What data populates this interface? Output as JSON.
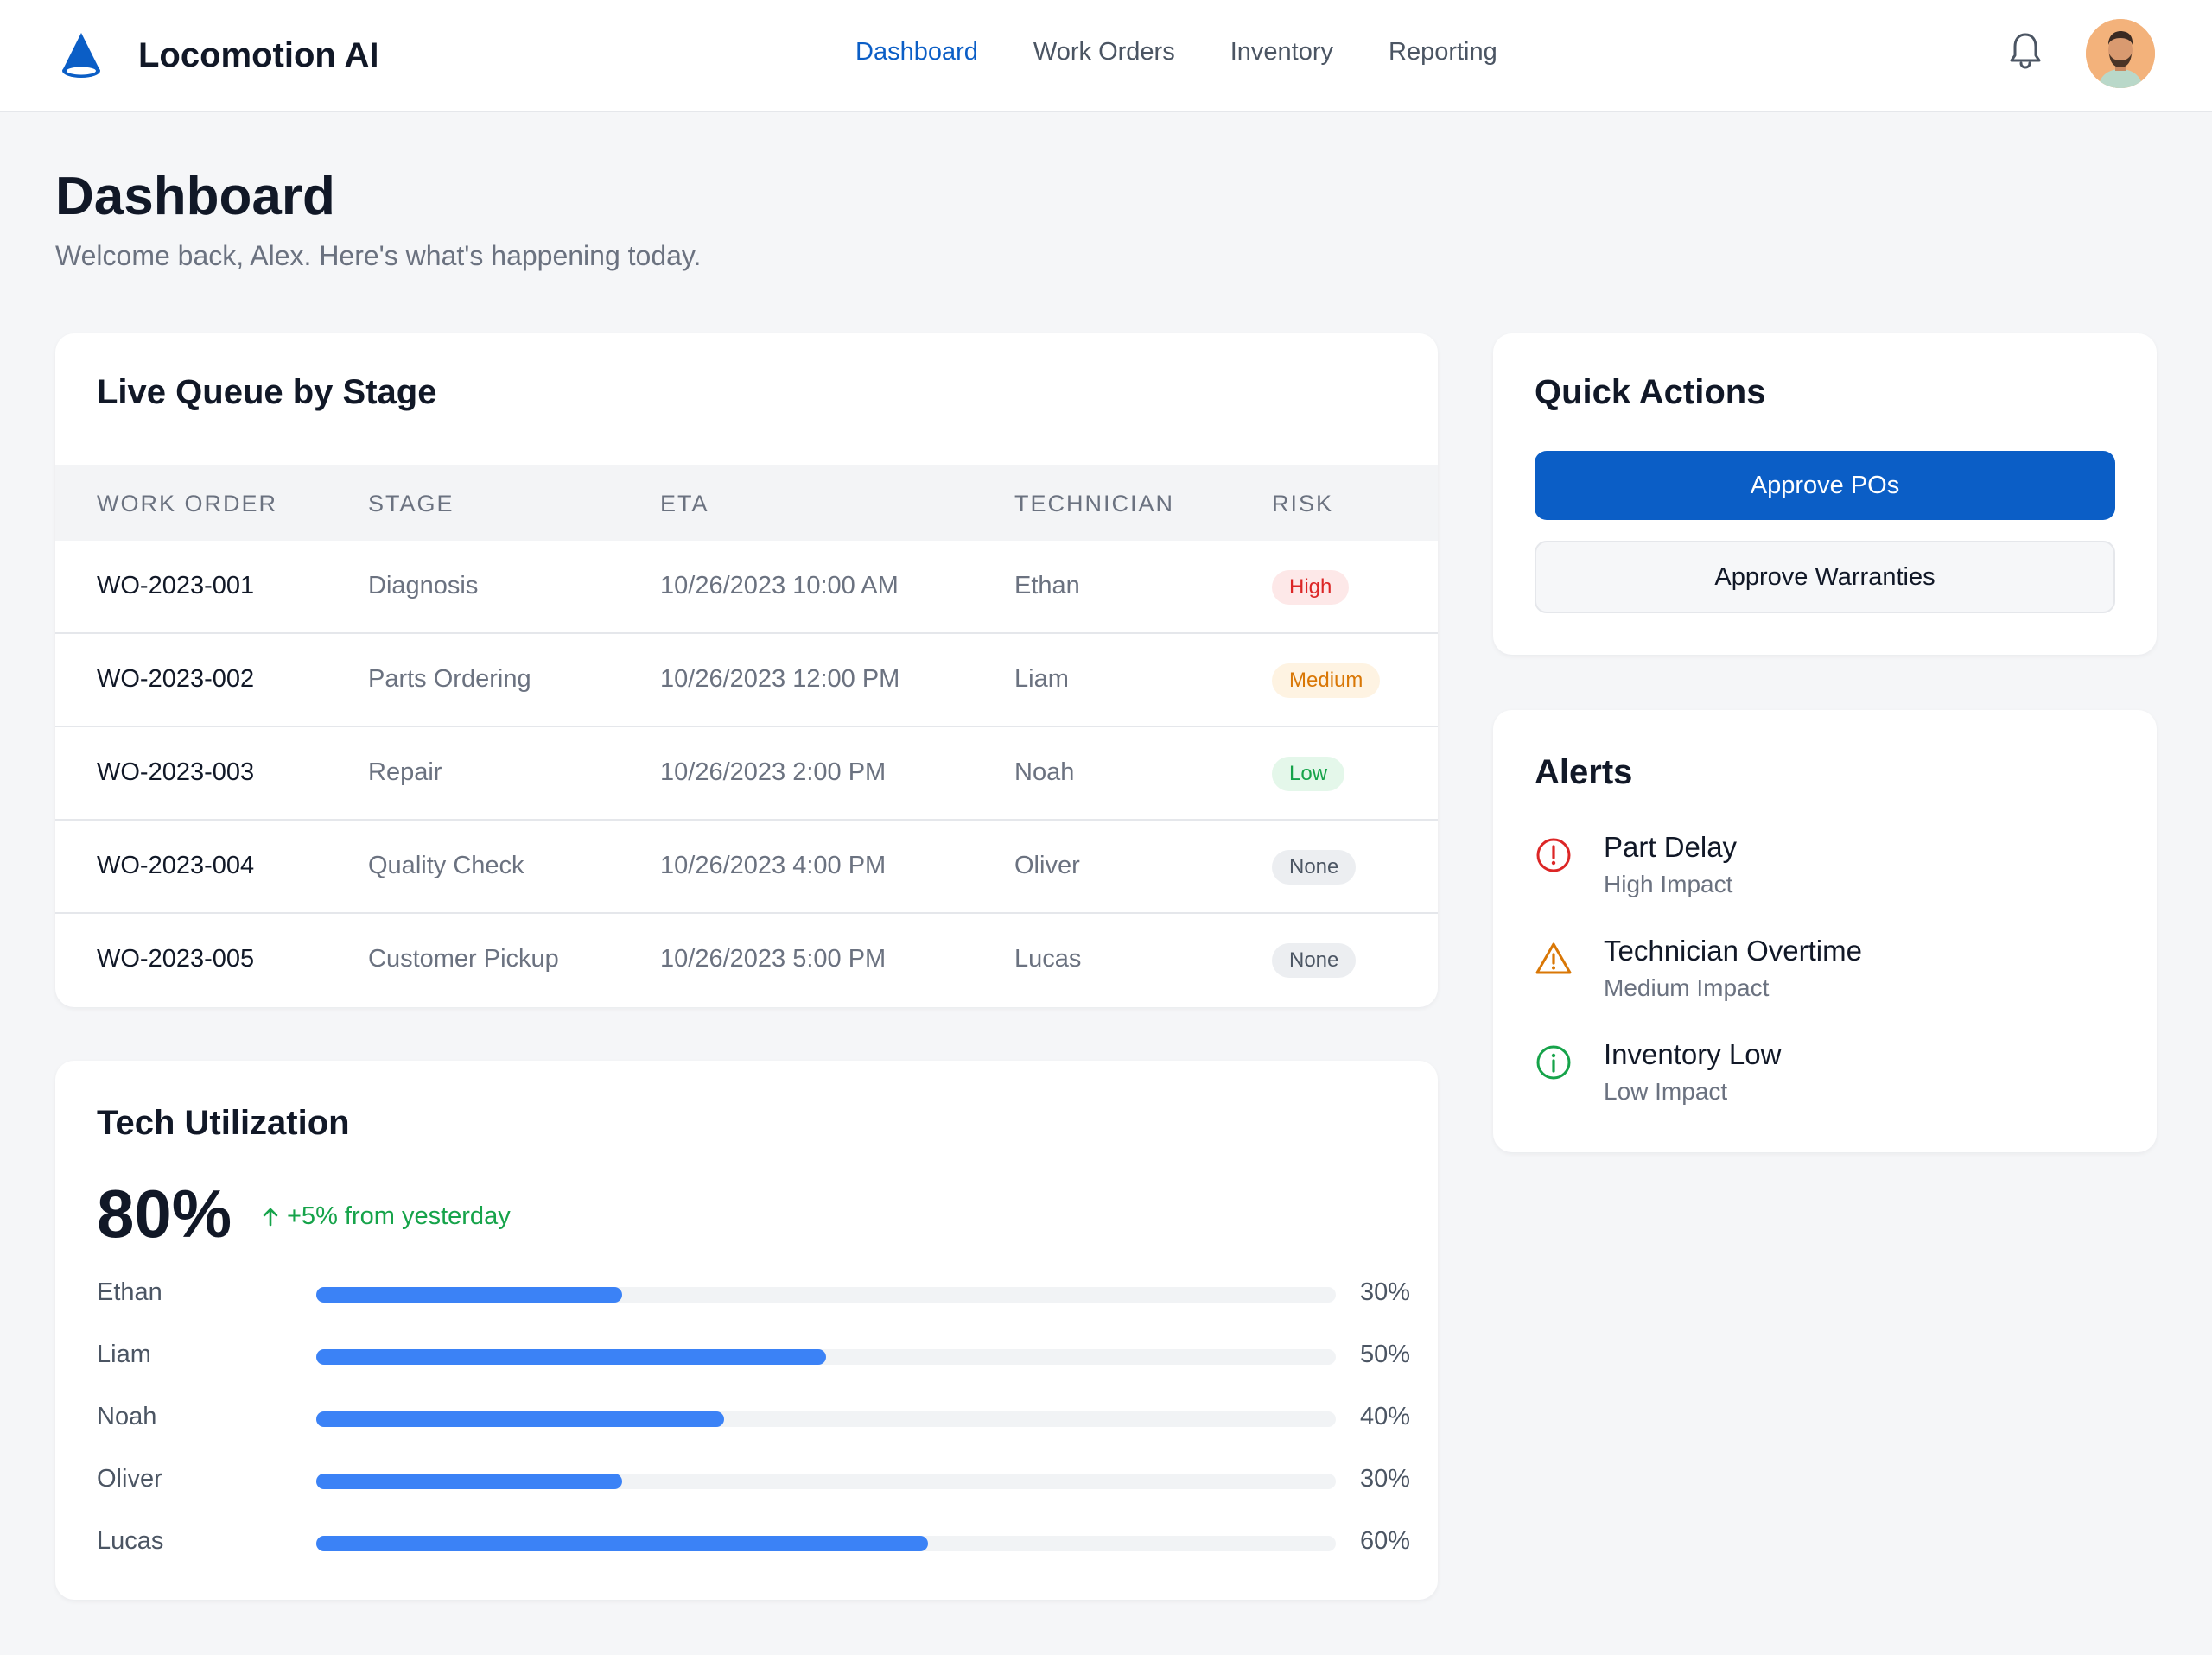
{
  "app": {
    "name": "Locomotion AI"
  },
  "nav": {
    "items": [
      {
        "label": "Dashboard",
        "active": true
      },
      {
        "label": "Work Orders",
        "active": false
      },
      {
        "label": "Inventory",
        "active": false
      },
      {
        "label": "Reporting",
        "active": false
      }
    ]
  },
  "header": {
    "icons": [
      "bell-icon",
      "user-avatar"
    ]
  },
  "page": {
    "title": "Dashboard",
    "subtitle": "Welcome back, Alex. Here's what's happening today."
  },
  "queue": {
    "title": "Live Queue by Stage",
    "columns": [
      "WORK ORDER",
      "STAGE",
      "ETA",
      "TECHNICIAN",
      "RISK"
    ],
    "rows": [
      {
        "wo": "WO-2023-001",
        "stage": "Diagnosis",
        "eta": "10/26/2023 10:00 AM",
        "tech": "Ethan",
        "risk": "High",
        "level": "high"
      },
      {
        "wo": "WO-2023-002",
        "stage": "Parts Ordering",
        "eta": "10/26/2023 12:00 PM",
        "tech": "Liam",
        "risk": "Medium",
        "level": "medium"
      },
      {
        "wo": "WO-2023-003",
        "stage": "Repair",
        "eta": "10/26/2023 2:00 PM",
        "tech": "Noah",
        "risk": "Low",
        "level": "low"
      },
      {
        "wo": "WO-2023-004",
        "stage": "Quality Check",
        "eta": "10/26/2023 4:00 PM",
        "tech": "Oliver",
        "risk": "None",
        "level": "none"
      },
      {
        "wo": "WO-2023-005",
        "stage": "Customer Pickup",
        "eta": "10/26/2023 5:00 PM",
        "tech": "Lucas",
        "risk": "None",
        "level": "none"
      }
    ]
  },
  "utilization": {
    "title": "Tech Utilization",
    "value": "80%",
    "delta": "+5% from yesterday",
    "techs": [
      {
        "name": "Ethan",
        "percent": 30,
        "label": "30%"
      },
      {
        "name": "Liam",
        "percent": 50,
        "label": "50%"
      },
      {
        "name": "Noah",
        "percent": 40,
        "label": "40%"
      },
      {
        "name": "Oliver",
        "percent": 30,
        "label": "30%"
      },
      {
        "name": "Lucas",
        "percent": 60,
        "label": "60%"
      }
    ]
  },
  "quick_actions": {
    "title": "Quick Actions",
    "primary": "Approve POs",
    "secondary": "Approve Warranties"
  },
  "alerts": {
    "title": "Alerts",
    "items": [
      {
        "title": "Part Delay",
        "impact": "High Impact",
        "icon": "exclamation-circle-icon",
        "color": "#dc2626"
      },
      {
        "title": "Technician Overtime",
        "impact": "Medium Impact",
        "icon": "warning-triangle-icon",
        "color": "#d97706"
      },
      {
        "title": "Inventory Low",
        "impact": "Low Impact",
        "icon": "info-circle-icon",
        "color": "#16a34a"
      }
    ]
  },
  "colors": {
    "accent": "#0b5ec6",
    "bar": "#3b82f6",
    "positive": "#16a34a"
  }
}
